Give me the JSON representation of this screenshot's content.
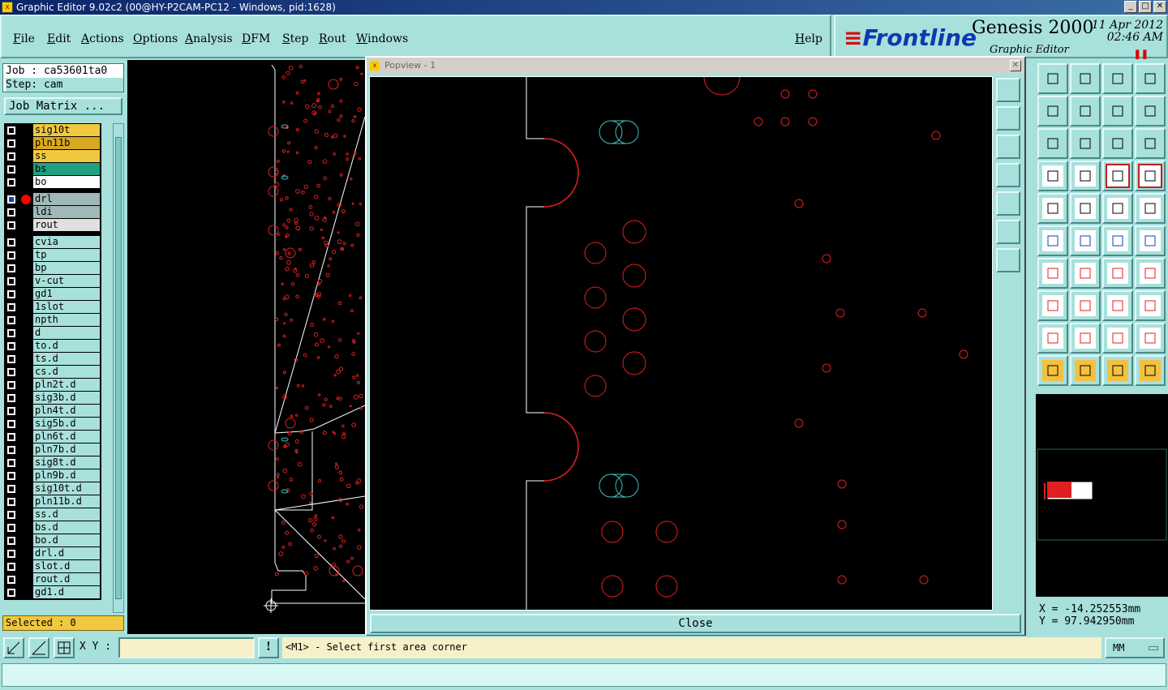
{
  "window": {
    "title": "Graphic Editor 9.02c2 (00@HY-P2CAM-PC12 - Windows, pid:1628)"
  },
  "menu": [
    "File",
    "Edit",
    "Actions",
    "Options",
    "Analysis",
    "DFM",
    "Step",
    "Rout",
    "Windows"
  ],
  "help_label": "Help",
  "brand": {
    "logo": "Frontline",
    "product": "Genesis 2000",
    "subtitle": "Graphic Editor",
    "date": "11 Apr 2012",
    "time": "02:46 AM"
  },
  "job": {
    "job_line": "Job : ca53601ta0",
    "step_line": "Step: cam",
    "matrix_button": "Job Matrix ..."
  },
  "layers": [
    {
      "name": "sig10t",
      "color": "#f0c840"
    },
    {
      "name": "pln11b",
      "color": "#d8a820"
    },
    {
      "name": "ss",
      "color": "#f0c840"
    },
    {
      "name": "bs",
      "color": "#20a080"
    },
    {
      "name": "bo",
      "color": "#ffffff"
    },
    {
      "name": "drl",
      "color": "#a0b8b8"
    },
    {
      "name": "ldi",
      "color": "#a0b8b8"
    },
    {
      "name": "rout",
      "color": "#e0e0e0"
    },
    {
      "name": "cvia",
      "color": "#a8e0dc"
    },
    {
      "name": "tp",
      "color": "#a8e0dc"
    },
    {
      "name": "bp",
      "color": "#a8e0dc"
    },
    {
      "name": "v-cut",
      "color": "#a8e0dc"
    },
    {
      "name": "gd1",
      "color": "#a8e0dc"
    },
    {
      "name": "1slot",
      "color": "#a8e0dc"
    },
    {
      "name": "npth",
      "color": "#a8e0dc"
    },
    {
      "name": "d",
      "color": "#a8e0dc"
    },
    {
      "name": "to.d",
      "color": "#a8e0dc"
    },
    {
      "name": "ts.d",
      "color": "#a8e0dc"
    },
    {
      "name": "cs.d",
      "color": "#a8e0dc"
    },
    {
      "name": "pln2t.d",
      "color": "#a8e0dc"
    },
    {
      "name": "sig3b.d",
      "color": "#a8e0dc"
    },
    {
      "name": "pln4t.d",
      "color": "#a8e0dc"
    },
    {
      "name": "sig5b.d",
      "color": "#a8e0dc"
    },
    {
      "name": "pln6t.d",
      "color": "#a8e0dc"
    },
    {
      "name": "pln7b.d",
      "color": "#a8e0dc"
    },
    {
      "name": "sig8t.d",
      "color": "#a8e0dc"
    },
    {
      "name": "pln9b.d",
      "color": "#a8e0dc"
    },
    {
      "name": "sig10t.d",
      "color": "#a8e0dc"
    },
    {
      "name": "pln11b.d",
      "color": "#a8e0dc"
    },
    {
      "name": "ss.d",
      "color": "#a8e0dc"
    },
    {
      "name": "bs.d",
      "color": "#a8e0dc"
    },
    {
      "name": "bo.d",
      "color": "#a8e0dc"
    },
    {
      "name": "drl.d",
      "color": "#a8e0dc"
    },
    {
      "name": "slot.d",
      "color": "#a8e0dc"
    },
    {
      "name": "rout.d",
      "color": "#a8e0dc"
    },
    {
      "name": "gd1.d",
      "color": "#a8e0dc"
    }
  ],
  "selected_status": "Selected : 0",
  "popview": {
    "title": "Popview - 1",
    "close_label": "Close"
  },
  "coords": {
    "x_line": "X = -14.252553mm",
    "y_line": "Y = 97.942950mm"
  },
  "bottom": {
    "xy_label": "X Y :",
    "xy_value": "",
    "message": "<M1> - Select first area corner",
    "units": "MM"
  },
  "colors": {
    "pad": "#e02020",
    "selected_pad": "#40c0c0",
    "outline": "#ffffff",
    "panel": "#a8e0dc"
  }
}
